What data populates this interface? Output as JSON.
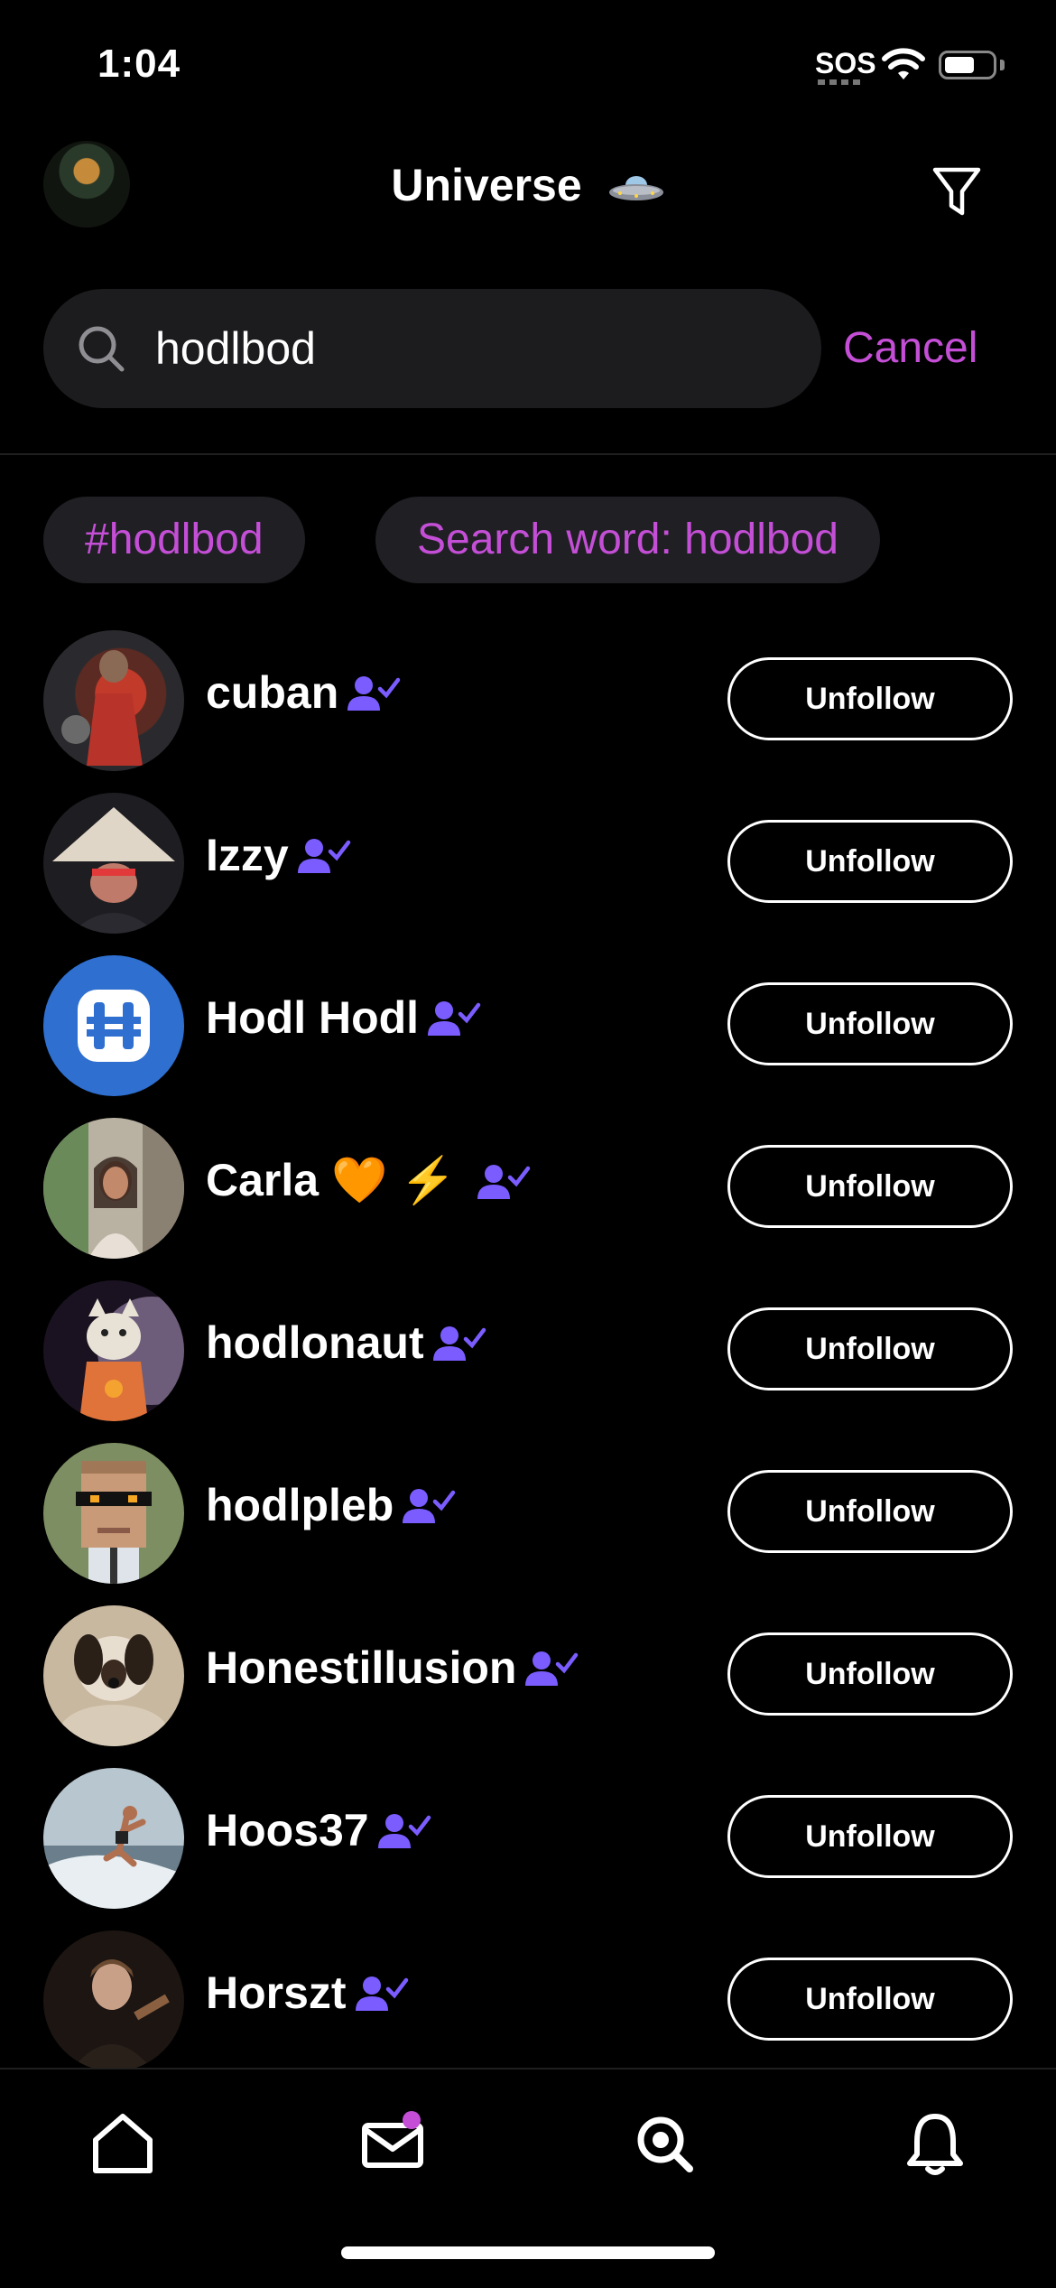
{
  "status_bar": {
    "time": "1:04",
    "sos": "SOS"
  },
  "header": {
    "title": "Universe",
    "title_emoji_icon": "ufo-icon",
    "filter_icon": "filter-icon"
  },
  "search": {
    "value": "hodlbod",
    "placeholder": "",
    "cancel_label": "Cancel"
  },
  "chips": [
    "#hodlbod",
    "Search word: hodlbod"
  ],
  "results": [
    {
      "name": "cuban",
      "action": "Unfollow"
    },
    {
      "name": "Izzy",
      "action": "Unfollow"
    },
    {
      "name": "Hodl Hodl",
      "action": "Unfollow"
    },
    {
      "name": "Carla 🧡 ⚡️",
      "action": "Unfollow"
    },
    {
      "name": "hodlonaut",
      "action": "Unfollow"
    },
    {
      "name": "hodlpleb",
      "action": "Unfollow"
    },
    {
      "name": "Honestillusion",
      "action": "Unfollow"
    },
    {
      "name": "Hoos37",
      "action": "Unfollow"
    },
    {
      "name": "Horszt",
      "action": "Unfollow"
    }
  ],
  "tabbar": {
    "items": [
      "home-icon",
      "mail-icon",
      "search-icon",
      "bell-icon"
    ],
    "mail_unread_dot": true
  },
  "colors": {
    "accent": "#c44fd6",
    "badge": "#7b5cff",
    "background": "#000000",
    "chip_bg": "#1f1f24"
  }
}
